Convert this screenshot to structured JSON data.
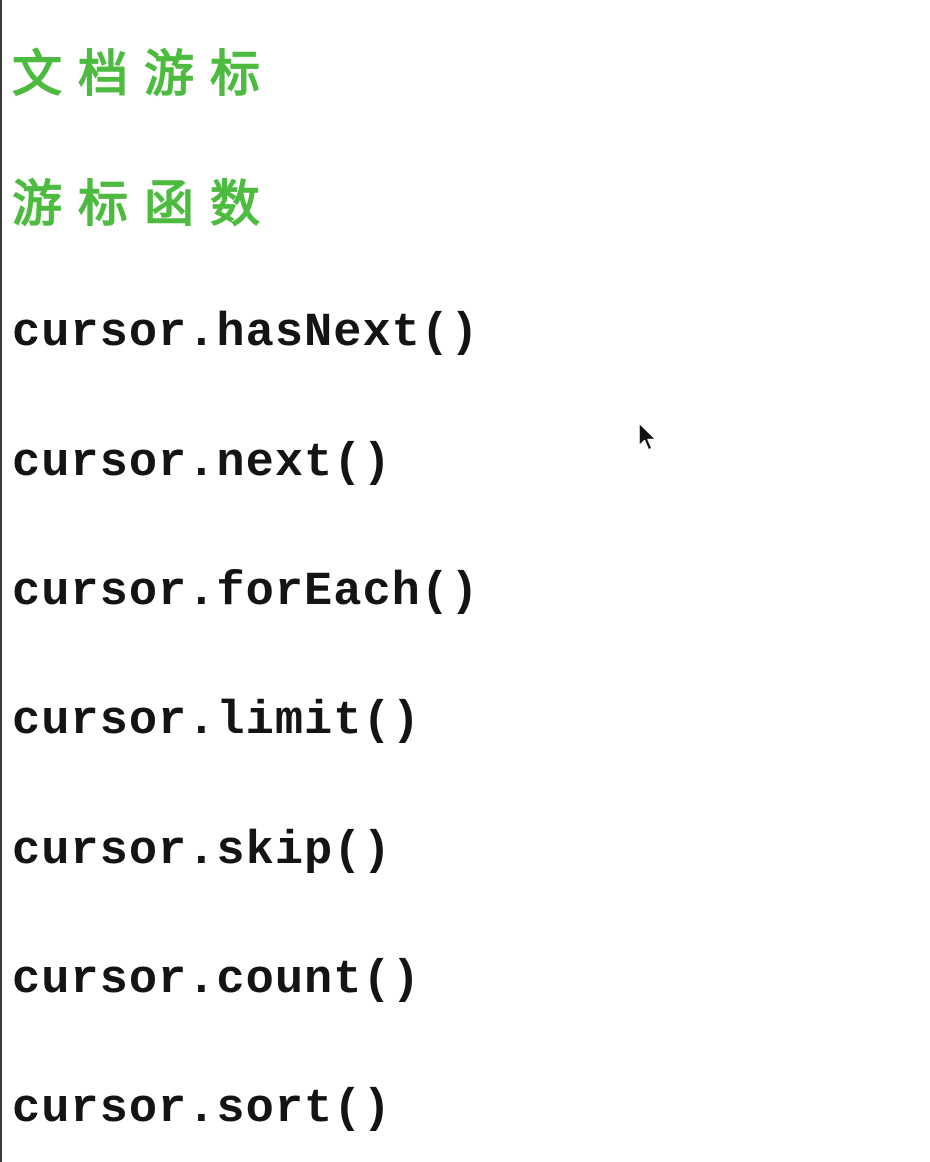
{
  "headings": {
    "doc_cursor": "文档游标",
    "cursor_functions": "游标函数"
  },
  "functions": [
    "cursor.hasNext()",
    "cursor.next()",
    "cursor.forEach()",
    "cursor.limit()",
    "cursor.skip()",
    "cursor.count()",
    "cursor.sort()"
  ],
  "colors": {
    "heading": "#4cbb3f",
    "code_text": "#141414",
    "background": "#ffffff"
  },
  "icons": {
    "pointer": "mouse-pointer-icon"
  }
}
